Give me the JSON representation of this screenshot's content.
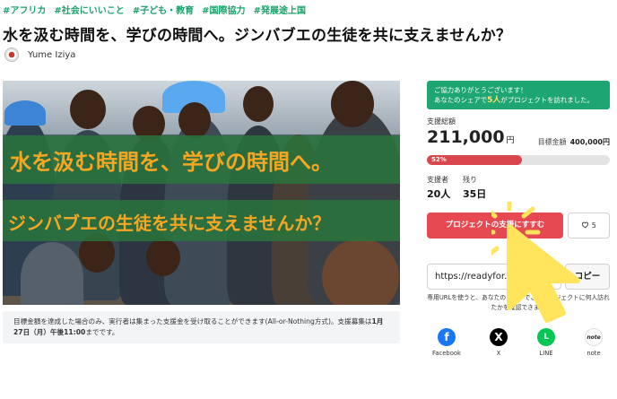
{
  "tags": [
    "#アフリカ",
    "#社会にいいこと",
    "#子ども・教育",
    "#国際協力",
    "#発展途上国"
  ],
  "title": "水を汲む時間を、学びの時間へ。ジンバブエの生徒を共に支えませんか？",
  "author": {
    "name": "Yume Iziya"
  },
  "hero": {
    "line1": "水を汲む時間を、学びの時間へ。",
    "line2": "ジンバブエの生徒を共に支えませんか？"
  },
  "notice": {
    "text_a": "目標金額を達成した場合のみ、実行者は集まった支援金を受け取ることができます(All-or-Nothing方式)。支援募集は",
    "deadline": "1月27日（月）午後11:00",
    "text_b": "までです。"
  },
  "thanks": {
    "line1": "ご協力ありがとうございます！",
    "line2_a": "あなたのシェアで",
    "line2_count": "5人",
    "line2_b": "がプロジェクトを訪れました。"
  },
  "funding": {
    "label": "支援総額",
    "amount": "211,000",
    "unit": "円",
    "goal_label": "目標金額",
    "goal_value": "400,000円",
    "progress_label": "52%",
    "progress": 0.52
  },
  "stats": {
    "supporters_label": "支援者",
    "supporters_value": "20人",
    "remaining_label": "残り",
    "remaining_value": "35日"
  },
  "actions": {
    "support_label": "プロジェクトの支援にすすむ",
    "like_count": "5",
    "like_icon": "heart-icon",
    "url_value": "https://readyfor.jp/",
    "copy_label": "コピー",
    "share_note": "専用URLを使うと、あなたのシェアでこのプロジェクトに何人訪れたかを確認できます"
  },
  "social": [
    {
      "label": "Facebook",
      "glyph": "f",
      "color": "#1877f2"
    },
    {
      "label": "X",
      "glyph": "X",
      "color": "#000000"
    },
    {
      "label": "LINE",
      "glyph": "L",
      "color": "#06c755"
    },
    {
      "label": "note",
      "glyph": "note",
      "color": "#ffffff"
    }
  ],
  "colors": {
    "tag": "#1aa36a",
    "accent_red": "#e64952",
    "banner_text": "#f5a623",
    "pointer": "#ffe45c"
  }
}
